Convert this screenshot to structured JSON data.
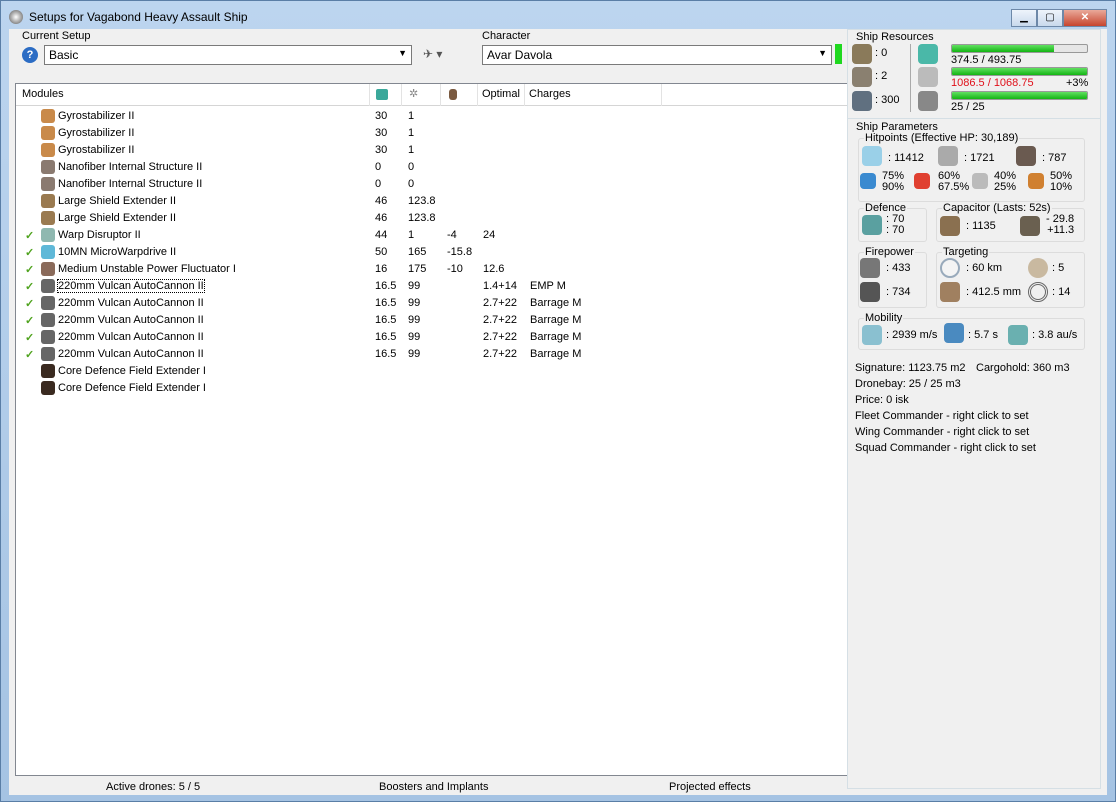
{
  "window": {
    "title": "Setups for Vagabond Heavy Assault Ship"
  },
  "setup": {
    "label": "Current Setup",
    "value": "Basic"
  },
  "character": {
    "label": "Character",
    "value": "Avar Davola"
  },
  "modules": {
    "headers": {
      "name": "Modules",
      "cpu_icon": "cpu-icon",
      "pg_icon": "powergrid-icon",
      "cap_icon": "capacitor-icon",
      "optimal": "Optimal",
      "charges": "Charges"
    },
    "rows": [
      {
        "active": false,
        "icon": "gyrostabilizer-icon",
        "color": "#c98a4a",
        "name": "Gyrostabilizer II",
        "cpu": "30",
        "pg": "1",
        "cap": "",
        "optimal": "",
        "charge": ""
      },
      {
        "active": false,
        "icon": "gyrostabilizer-icon",
        "color": "#c98a4a",
        "name": "Gyrostabilizer II",
        "cpu": "30",
        "pg": "1",
        "cap": "",
        "optimal": "",
        "charge": ""
      },
      {
        "active": false,
        "icon": "gyrostabilizer-icon",
        "color": "#c98a4a",
        "name": "Gyrostabilizer II",
        "cpu": "30",
        "pg": "1",
        "cap": "",
        "optimal": "",
        "charge": ""
      },
      {
        "active": false,
        "icon": "nanofiber-icon",
        "color": "#8a7a70",
        "name": "Nanofiber Internal Structure II",
        "cpu": "0",
        "pg": "0",
        "cap": "",
        "optimal": "",
        "charge": ""
      },
      {
        "active": false,
        "icon": "nanofiber-icon",
        "color": "#8a7a70",
        "name": "Nanofiber Internal Structure II",
        "cpu": "0",
        "pg": "0",
        "cap": "",
        "optimal": "",
        "charge": ""
      },
      {
        "active": false,
        "icon": "shield-extender-icon",
        "color": "#9a7a50",
        "name": "Large Shield Extender II",
        "cpu": "46",
        "pg": "123.8",
        "cap": "",
        "optimal": "",
        "charge": ""
      },
      {
        "active": false,
        "icon": "shield-extender-icon",
        "color": "#9a7a50",
        "name": "Large Shield Extender II",
        "cpu": "46",
        "pg": "123.8",
        "cap": "",
        "optimal": "",
        "charge": ""
      },
      {
        "active": true,
        "icon": "warp-disruptor-icon",
        "color": "#8fb8b0",
        "name": "Warp Disruptor II",
        "cpu": "44",
        "pg": "1",
        "cap": "-4",
        "optimal": "24",
        "charge": ""
      },
      {
        "active": true,
        "icon": "microwarpdrive-icon",
        "color": "#5fb8d8",
        "name": "10MN MicroWarpdrive II",
        "cpu": "50",
        "pg": "165",
        "cap": "-15.8",
        "optimal": "",
        "charge": ""
      },
      {
        "active": true,
        "icon": "power-fluctuator-icon",
        "color": "#8a6a5a",
        "name": "Medium Unstable Power Fluctuator I",
        "cpu": "16",
        "pg": "175",
        "cap": "-10",
        "optimal": "12.6",
        "charge": ""
      },
      {
        "active": true,
        "icon": "autocannon-icon",
        "color": "#666",
        "name": "220mm Vulcan AutoCannon II",
        "cpu": "16.5",
        "pg": "99",
        "cap": "",
        "optimal": "1.4+14",
        "charge": "EMP M"
      },
      {
        "active": true,
        "icon": "autocannon-icon",
        "color": "#666",
        "name": "220mm Vulcan AutoCannon II",
        "cpu": "16.5",
        "pg": "99",
        "cap": "",
        "optimal": "2.7+22",
        "charge": "Barrage M"
      },
      {
        "active": true,
        "icon": "autocannon-icon",
        "color": "#666",
        "name": "220mm Vulcan AutoCannon II",
        "cpu": "16.5",
        "pg": "99",
        "cap": "",
        "optimal": "2.7+22",
        "charge": "Barrage M"
      },
      {
        "active": true,
        "icon": "autocannon-icon",
        "color": "#666",
        "name": "220mm Vulcan AutoCannon II",
        "cpu": "16.5",
        "pg": "99",
        "cap": "",
        "optimal": "2.7+22",
        "charge": "Barrage M"
      },
      {
        "active": true,
        "icon": "autocannon-icon",
        "color": "#666",
        "name": "220mm Vulcan AutoCannon II",
        "cpu": "16.5",
        "pg": "99",
        "cap": "",
        "optimal": "2.7+22",
        "charge": "Barrage M"
      },
      {
        "active": false,
        "icon": "core-defence-icon",
        "color": "#3a2a20",
        "name": "Core Defence Field Extender I",
        "cpu": "",
        "pg": "",
        "cap": "",
        "optimal": "",
        "charge": ""
      },
      {
        "active": false,
        "icon": "core-defence-icon",
        "color": "#3a2a20",
        "name": "Core Defence Field Extender I",
        "cpu": "",
        "pg": "",
        "cap": "",
        "optimal": "",
        "charge": ""
      }
    ]
  },
  "bottom": {
    "drones": "Active drones: 5 / 5",
    "boosters": "Boosters and Implants",
    "projected": "Projected effects"
  },
  "resources": {
    "title": "Ship Resources",
    "turret_hardpoints": ": 0",
    "launcher_hardpoints": ": 2",
    "drone_bandwidth": ": 300",
    "cpu": {
      "text": "374.5 / 493.75",
      "fraction": 0.758
    },
    "powergrid": {
      "text": "1086.5 / 1068.75",
      "extra": "+3%",
      "fraction": 1.0
    },
    "drones": {
      "text": "25 / 25",
      "fraction": 1.0
    },
    "over_color": "#e0101a",
    "bar_color": "#1fbf1f"
  },
  "params": {
    "title": "Ship Parameters",
    "hitpoints": {
      "title": "Hitpoints (Effective HP: 30,189)",
      "shield": ": 11412",
      "armor": ": 1721",
      "structure": ": 787",
      "em": [
        "75%",
        "90%"
      ],
      "thermal": [
        "60%",
        "67.5%"
      ],
      "kinetic": [
        "40%",
        "25%"
      ],
      "explosive": [
        "50%",
        "10%"
      ]
    },
    "defence": {
      "title": "Defence",
      "a": ": 70",
      "b": ": 70"
    },
    "capacitor": {
      "title": "Capacitor (Lasts: 52s)",
      "capacity": ": 1135",
      "use": "- 29.8",
      "recharge": "+11.3"
    },
    "firepower": {
      "title": "Firepower",
      "dps": ": 433",
      "volley": ": 734"
    },
    "targeting": {
      "title": "Targeting",
      "range": ": 60 km",
      "targets": ": 5",
      "resolution": ": 412.5 mm",
      "sensor": ": 14"
    },
    "mobility": {
      "title": "Mobility",
      "speed": ": 2939 m/s",
      "align": ": 5.7 s",
      "warp": ": 3.8 au/s"
    }
  },
  "info": [
    "Signature: 1123.75 m2",
    "Cargohold: 360 m3",
    "Dronebay: 25 / 25 m3",
    "Price: 0 isk",
    "Fleet Commander - right click to set",
    "Wing Commander - right click to set",
    "Squad Commander - right click to set"
  ]
}
